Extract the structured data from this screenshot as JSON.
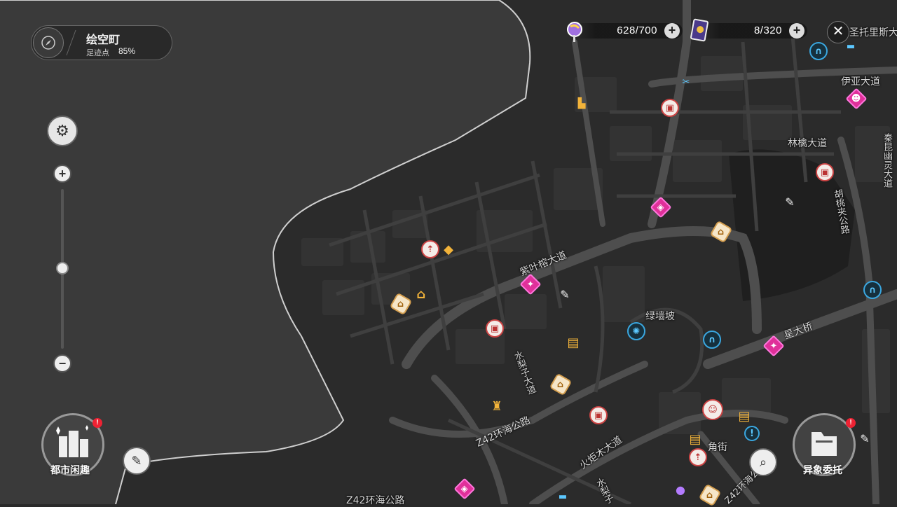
{
  "location": {
    "name": "绘空町",
    "footprint_label": "足迹点",
    "footprint_value": "85%"
  },
  "resources": [
    {
      "name": "energy",
      "value": "628/700",
      "icon": "lollipop-icon"
    },
    {
      "name": "cards",
      "value": "8/320",
      "icon": "card-icon"
    }
  ],
  "road_labels": [
    "圣托里斯大",
    "伊亚大道",
    "林檎大道",
    "秦昆幽灵大道",
    "胡桃夹公路",
    "紫叶榕大道",
    "绿墙坡",
    "星大桥",
    "水梨子大道",
    "Z42环海公路",
    "火炬木大道",
    "角街",
    "Z42环海公路",
    "Z42环海公",
    "水梨子"
  ],
  "buttons": {
    "city_fun": "都市闲趣",
    "anomaly": "异象委托",
    "close": "✕",
    "alert": "!"
  },
  "colors": {
    "water": "#3b3b3b",
    "land": "#2a2a2a",
    "road": "#4d4d4d",
    "accent_pink": "#e0309a",
    "accent_blue": "#3aa7e0"
  }
}
